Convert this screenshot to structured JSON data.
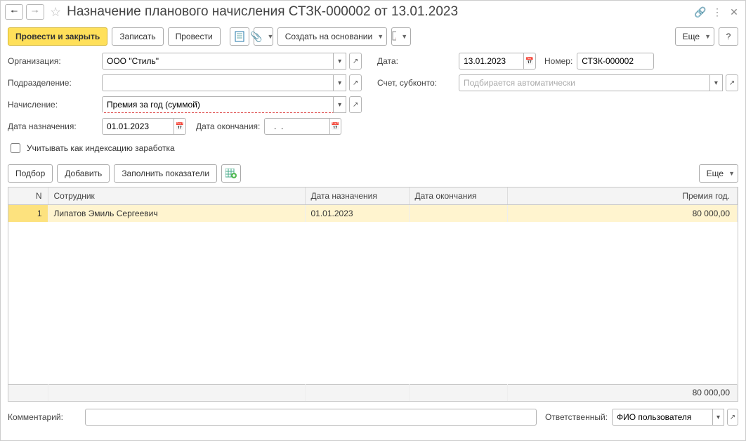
{
  "titlebar": {
    "title": "Назначение планового начисления СТЗК-000002 от 13.01.2023"
  },
  "toolbar": {
    "post_close": "Провести и закрыть",
    "save": "Записать",
    "post": "Провести",
    "create_based": "Создать на основании",
    "more": "Еще",
    "help": "?"
  },
  "form": {
    "org_label": "Организация:",
    "org_value": "ООО \"Стиль\"",
    "date_label": "Дата:",
    "date_value": "13.01.2023",
    "number_label": "Номер:",
    "number_value": "СТЗК-000002",
    "dept_label": "Подразделение:",
    "dept_value": "",
    "account_label": "Счет, субконто:",
    "account_placeholder": "Подбирается автоматически",
    "accrual_label": "Начисление:",
    "accrual_value": "Премия за год (суммой)",
    "assign_date_label": "Дата назначения:",
    "assign_date_value": "01.01.2023",
    "end_date_label": "Дата окончания:",
    "end_date_value": "  .  .    ",
    "index_checkbox": "Учитывать как индексацию заработка"
  },
  "section_toolbar": {
    "pick": "Подбор",
    "add": "Добавить",
    "fill": "Заполнить показатели",
    "more": "Еще"
  },
  "table": {
    "headers": {
      "n": "N",
      "employee": "Сотрудник",
      "assign_date": "Дата назначения",
      "end_date": "Дата окончания",
      "bonus": "Премия год."
    },
    "rows": [
      {
        "n": "1",
        "employee": "Липатов Эмиль Сергеевич",
        "assign_date": "01.01.2023",
        "end_date": "",
        "bonus": "80 000,00"
      }
    ],
    "total_bonus": "80 000,00"
  },
  "bottom": {
    "comment_label": "Комментарий:",
    "comment_value": "",
    "responsible_label": "Ответственный:",
    "responsible_value": "ФИО пользователя"
  }
}
